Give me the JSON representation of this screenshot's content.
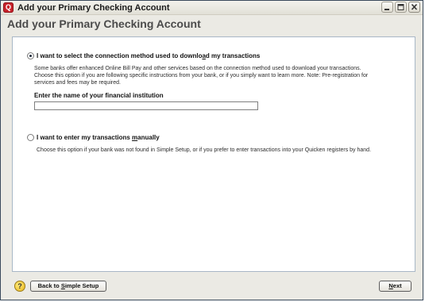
{
  "window": {
    "title": "Add your Primary Checking Account",
    "app_icon": "quicken-q-icon",
    "app_icon_glyph": "Q",
    "controls": [
      "minimize-icon",
      "maximize-icon",
      "close-icon"
    ]
  },
  "header": {
    "title": "Add your Primary Checking Account"
  },
  "option_download": {
    "selected": true,
    "label_pre": "I want to select the connection method used to downlo",
    "label_mnemonic": "a",
    "label_post": "d my transactions",
    "description_lines": [
      "Some banks offer enhanced Online Bill Pay and other services based on the connection method used to download your transactions.",
      "Choose this option if you are following specific instructions from your bank, or if you simply want to learn more. Note: Pre-registration for",
      "services and fees may be required."
    ],
    "institution_label": "Enter the name of your financial institution",
    "institution_value": ""
  },
  "option_manual": {
    "selected": false,
    "label_pre": "I want to enter my transactions ",
    "label_mnemonic": "m",
    "label_post": "anually",
    "description": "Choose this option if your bank was not found in Simple Setup, or if you prefer to enter transactions into your Quicken registers by hand."
  },
  "footer": {
    "help_icon": "help-question-icon",
    "help_glyph": "?",
    "back_pre": "Back to ",
    "back_mnemonic": "S",
    "back_post": "imple Setup",
    "next_pre": "",
    "next_mnemonic": "N",
    "next_post": "ext"
  }
}
